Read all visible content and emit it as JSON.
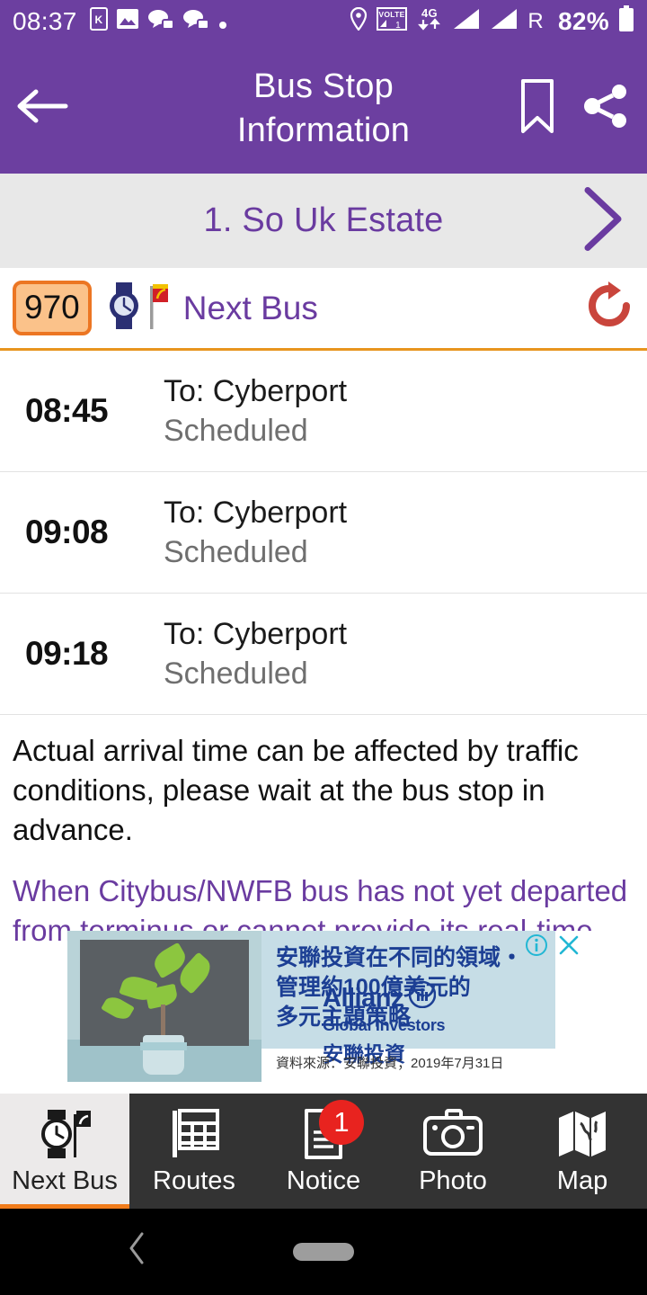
{
  "status_bar": {
    "clock": "08:37",
    "battery": "82%",
    "network_type": "4G",
    "volte_label": "VOLTE",
    "roaming": "R",
    "left_icons": [
      "kakao-icon",
      "gallery-image-icon",
      "chat-message-icon",
      "chat-message-icon",
      "dot-icon"
    ],
    "right_icons": [
      "location-pin-icon",
      "volte-icon",
      "data-transfer-icon",
      "signal-bars-icon",
      "signal-bars-icon",
      "battery-icon"
    ]
  },
  "app_bar": {
    "title": "Bus Stop Information",
    "title_line1": "Bus Stop",
    "title_line2": "Information",
    "back_icon": "back-arrow-icon",
    "bookmark_icon": "bookmark-icon",
    "share_icon": "share-icon"
  },
  "stop_bar": {
    "stop_name": "1. So Uk Estate",
    "next_stop_icon": "chevron-right-icon"
  },
  "route_row": {
    "route_number": "970",
    "section_label": "Next Bus",
    "watch_icon": "watch-icon",
    "bus-stop_flag_icon": "bus-stop-flag-icon",
    "refresh_icon": "refresh-icon"
  },
  "arrivals": [
    {
      "time": "08:45",
      "destination": "To: Cyberport",
      "status": "Scheduled"
    },
    {
      "time": "09:08",
      "destination": "To: Cyberport",
      "status": "Scheduled"
    },
    {
      "time": "09:18",
      "destination": "To: Cyberport",
      "status": "Scheduled"
    }
  ],
  "disclaimer": {
    "black_text": "Actual arrival time can be affected by traffic conditions, please wait at the bus stop in advance.",
    "purple_text": "When Citybus/NWFB bus has not yet departed from terminus or cannot provide its real-time"
  },
  "advertisement": {
    "headline_line1": "安聯投資在不同的領域‧",
    "headline_line2": "管理約100億美元的",
    "headline_line3": "多元主題策略",
    "source_note": "資料來源：安聯投資；2019年7月31日",
    "brand_name": "Allianz",
    "brand_sub": "Global Investors",
    "brand_cn": "安聯投資",
    "info_icon": "ad-info-icon",
    "close_icon": "ad-close-icon"
  },
  "tab_bar": {
    "tabs": [
      {
        "label": "Next Bus",
        "icon": "watch-flag-icon",
        "active": true,
        "badge": ""
      },
      {
        "label": "Routes",
        "icon": "timetable-grid-icon",
        "active": false,
        "badge": ""
      },
      {
        "label": "Notice",
        "icon": "document-icon",
        "active": false,
        "badge": "1"
      },
      {
        "label": "Photo",
        "icon": "camera-icon",
        "active": false,
        "badge": ""
      },
      {
        "label": "Map",
        "icon": "map-icon",
        "active": false,
        "badge": ""
      }
    ]
  },
  "android_nav": {
    "back_icon": "nav-back-icon",
    "home_pill_icon": "nav-home-pill-icon"
  },
  "colors": {
    "brand_purple": "#6c3fa0",
    "accent_orange": "#e8951f",
    "badge_red": "#e8231f",
    "refresh_red": "#c9453c",
    "ad_blue": "#1c3f94"
  }
}
